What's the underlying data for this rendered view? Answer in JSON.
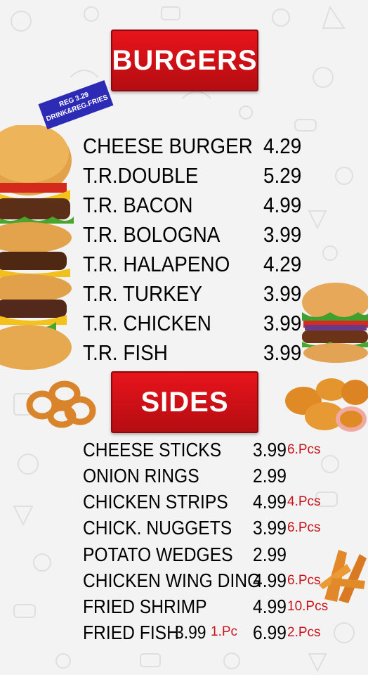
{
  "burgers": {
    "title": "BURGERS",
    "promo_tag": {
      "line1": "REG 3.29",
      "line2": "DRINK&REG.FRIES"
    },
    "items": [
      {
        "name": "CHEESE BURGER",
        "price": "4.29"
      },
      {
        "name": "T.R.DOUBLE",
        "price": "5.29"
      },
      {
        "name": "T.R. BACON",
        "price": "4.99"
      },
      {
        "name": "T.R. BOLOGNA",
        "price": "3.99"
      },
      {
        "name": "T.R. HALAPENO",
        "price": "4.29"
      },
      {
        "name": "T.R. TURKEY",
        "price": "3.99"
      },
      {
        "name": "T.R. CHICKEN",
        "price": "3.99"
      },
      {
        "name": "T.R. FISH",
        "price": "3.99"
      }
    ]
  },
  "sides": {
    "title": "SIDES",
    "items": [
      {
        "name": "CHEESE STICKS",
        "price": "3.99",
        "note": "6.Pcs"
      },
      {
        "name": "ONION RINGS",
        "price": "2.99",
        "note": ""
      },
      {
        "name": "CHICKEN STRIPS",
        "price": "4.99",
        "note": "4.Pcs"
      },
      {
        "name": "CHICK. NUGGETS",
        "price": "3.99",
        "note": "6.Pcs"
      },
      {
        "name": "POTATO WEDGES",
        "price": "2.99",
        "note": ""
      },
      {
        "name": "CHICKEN WING DING",
        "price": "4.99",
        "note": "6.Pcs"
      },
      {
        "name": "FRIED SHRIMP",
        "price": "4.99",
        "note": "10.Pcs"
      },
      {
        "name": "FRIED FISH",
        "price": "6.99",
        "note": "2.Pcs",
        "alt_price": "3.99",
        "alt_note": "1.Pc"
      }
    ]
  },
  "colors": {
    "banner_red": "#d81118",
    "note_red": "#c8141a",
    "tag_blue": "#2d2bb5"
  },
  "images": [
    "triple-stack-burger-photo",
    "single-burger-photo",
    "onion-rings-photo",
    "chicken-nuggets-photo",
    "potato-wedges-photo"
  ]
}
